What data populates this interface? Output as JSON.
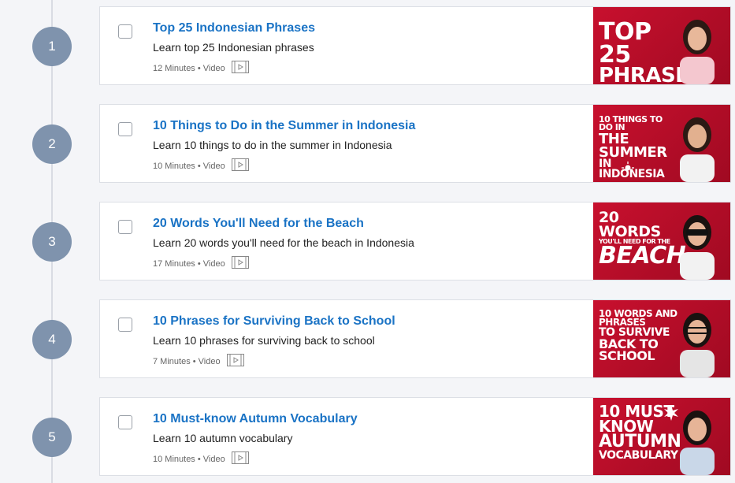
{
  "lessons": [
    {
      "number": "1",
      "title": "Top 25 Indonesian Phrases",
      "description": "Learn top 25 Indonesian phrases",
      "meta": "12 Minutes • Video",
      "thumbnail": {
        "line1": "TOP 25",
        "line2": "PHRASES",
        "line3": ""
      }
    },
    {
      "number": "2",
      "title": "10 Things to Do in the Summer in Indonesia",
      "description": "Learn 10 things to do in the summer in Indonesia",
      "meta": "10 Minutes • Video",
      "thumbnail": {
        "line1": "10 THINGS TO DO IN",
        "line2": "THE SUMMER",
        "line3": "IN INDONESIA"
      }
    },
    {
      "number": "3",
      "title": "20 Words You'll Need for the Beach",
      "description": "Learn 20 words you'll need for the beach in Indonesia",
      "meta": "17 Minutes • Video",
      "thumbnail": {
        "line1": "20 WORDS",
        "line2": "YOU'LL NEED FOR THE",
        "line3": "BEACH"
      }
    },
    {
      "number": "4",
      "title": "10 Phrases for Surviving Back to School",
      "description": "Learn 10 phrases for surviving back to school",
      "meta": "7 Minutes • Video",
      "thumbnail": {
        "line1": "10 WORDS AND PHRASES",
        "line2": "TO SURVIVE",
        "line3": "BACK TO SCHOOL"
      }
    },
    {
      "number": "5",
      "title": "10 Must-know Autumn Vocabulary",
      "description": "Learn 10 autumn vocabulary",
      "meta": "10 Minutes • Video",
      "thumbnail": {
        "line1": "10 MUST KNOW",
        "line2": "AUTUMN",
        "line3": "VOCABULARY"
      }
    }
  ],
  "colors": {
    "accent": "#1a73c5",
    "step": "#7f93ad",
    "thumb": "#c8102e"
  },
  "icons": {
    "video": "video-film-icon"
  }
}
